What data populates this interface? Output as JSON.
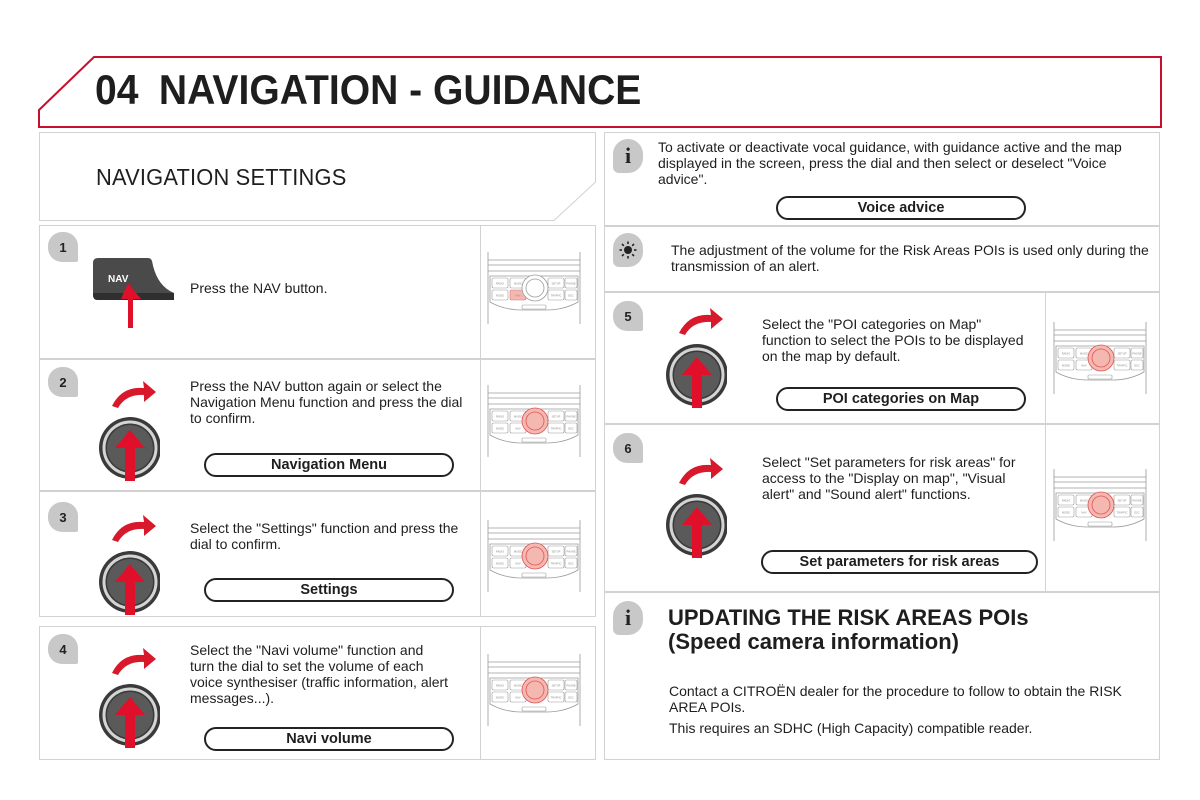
{
  "header": {
    "chapter_number": "04",
    "chapter_title": "NAVIGATION - GUIDANCE",
    "accent_color": "#c8102e"
  },
  "section": {
    "title": "NAVIGATION SETTINGS"
  },
  "steps": [
    {
      "number": "1",
      "icon": "nav-button-press-icon",
      "button_label": "NAV",
      "text": "Press the NAV button.",
      "menu_item": null,
      "console_highlight": "NAV button"
    },
    {
      "number": "2",
      "icon": "dial-rotate-press-icon",
      "text": "Press the NAV button again or select the Navigation Menu function and press the dial to confirm.",
      "menu_item": "Navigation Menu",
      "console_highlight": "dial"
    },
    {
      "number": "3",
      "icon": "dial-rotate-press-icon",
      "text": "Select the \"Settings\" function and press the dial to confirm.",
      "menu_item": "Settings",
      "console_highlight": "dial"
    },
    {
      "number": "4",
      "icon": "dial-rotate-press-icon",
      "text": "Select the \"Navi volume\" function and turn the dial to set the volume of each voice synthesiser (traffic information, alert messages...).",
      "menu_item": "Navi volume",
      "console_highlight": "dial"
    },
    {
      "number": "5",
      "icon": "dial-rotate-press-icon",
      "text": "Select the \"POI categories on Map\" function to select the POIs to be displayed on the map by default.",
      "menu_item": "POI categories on Map",
      "console_highlight": "dial"
    },
    {
      "number": "6",
      "icon": "dial-rotate-press-icon",
      "text": "Select \"Set parameters for risk areas\" for access to the \"Display on map\", \"Visual alert\" and \"Sound alert\" functions.",
      "menu_item": "Set parameters for risk areas",
      "console_highlight": "dial"
    }
  ],
  "notes": {
    "voice_advice": {
      "icon": "info-icon",
      "text": "To activate or deactivate vocal guidance, with guidance active and the map displayed in the screen, press the dial and then select or deselect \"Voice advice\".",
      "menu_item": "Voice advice"
    },
    "risk_volume": {
      "icon": "tip-lightbulb-icon",
      "text": "The adjustment of the volume for the Risk Areas POIs is used only during the transmission of an alert."
    },
    "updating": {
      "icon": "info-icon",
      "title_line1": "UPDATING THE RISK AREAS POIs",
      "title_line2": "(Speed camera information)",
      "paragraph1": "Contact a CITROËN dealer for the procedure to follow to obtain the RISK AREA POIs.",
      "paragraph2": "This requires an SDHC (High Capacity) compatible reader."
    }
  },
  "console_labels": {
    "radio": "RADIO",
    "music": "MUSIC",
    "setup": "SETUP",
    "phone": "PHONE",
    "mode": "MODE",
    "nav": "NAV",
    "traffic": "TRAFFIC",
    "esc": "ESC"
  },
  "colors": {
    "accent_red": "#c8102e",
    "highlight_pink": "#f4b8b0",
    "badge_gray": "#c8c8c8",
    "border_gray": "#d2d2d2"
  }
}
